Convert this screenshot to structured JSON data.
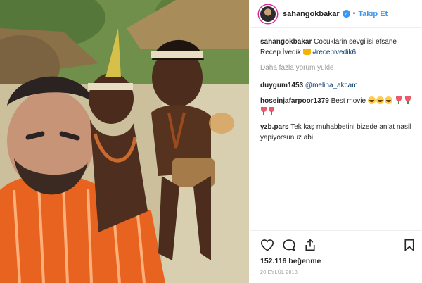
{
  "post": {
    "username": "sahangokbakar",
    "follow_label": "Takip Et",
    "separator": "•",
    "caption": {
      "username": "sahangokbakar",
      "text": "Cocuklarin sevgilisi efsane Recep İvedik",
      "hashtag": "#recepivedik6"
    },
    "load_more_label": "Daha fazla yorum yükle",
    "comments": [
      {
        "username": "duygum1453",
        "mention": "@melina_akcam",
        "text": ""
      },
      {
        "username": "hoseinjafarpoor1379",
        "text": "Best movie"
      },
      {
        "username": "yzb.pars",
        "text": "Tek kaş muhabbetini bizede anlat nasil yapiyorsunuz abi"
      }
    ],
    "likes": "152.116 beğenme",
    "date": "20 EYLÜL 2018",
    "icons": {
      "verified": "verified-badge-icon",
      "like": "heart-icon",
      "comment": "comment-bubble-icon",
      "share": "share-icon",
      "save": "bookmark-icon"
    },
    "colors": {
      "accent": "#3897f0",
      "muted": "#999999",
      "text": "#262626"
    }
  }
}
